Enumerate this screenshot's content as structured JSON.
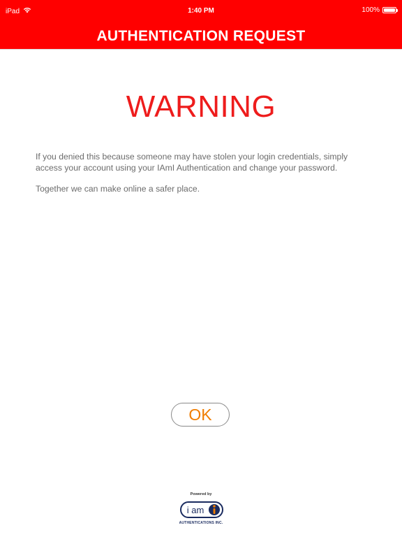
{
  "status_bar": {
    "device": "iPad",
    "time": "1:40 PM",
    "battery": "100%",
    "battery_level": 1.0
  },
  "header": {
    "title": "AUTHENTICATION REQUEST"
  },
  "main": {
    "heading": "WARNING",
    "paragraphs": [
      "If you denied this because someone may have stolen your login credentials, simply access your account using your IAmI Authentication and change your password.",
      "Together we can make online a safer place."
    ],
    "ok_label": "OK"
  },
  "footer": {
    "powered_by": "Powered by",
    "logo_text": "i am",
    "company": "AUTHENTICATIONS INC."
  },
  "colors": {
    "brand_red": "#ff0000",
    "warning_text": "#ee1c1c",
    "ok_text": "#f07d00",
    "logo_navy": "#1a2b5f"
  },
  "icons": [
    "wifi-icon",
    "battery-icon",
    "iam-logo"
  ]
}
